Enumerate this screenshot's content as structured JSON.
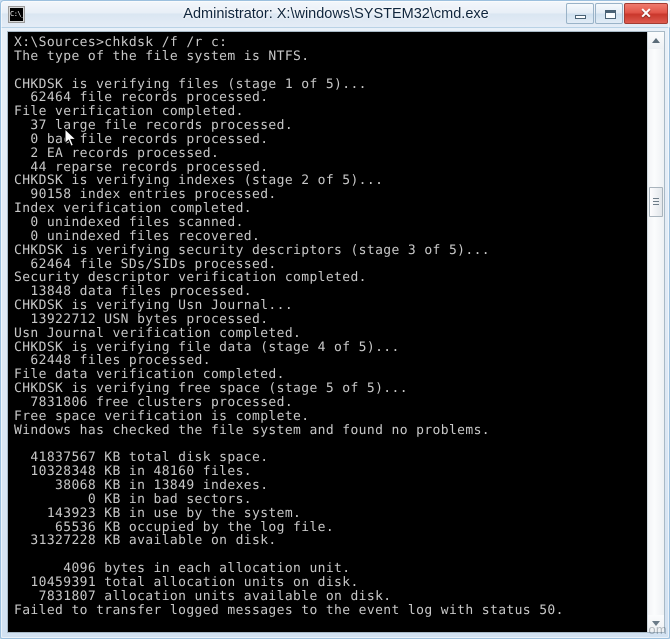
{
  "window": {
    "title": "Administrator: X:\\windows\\SYSTEM32\\cmd.exe",
    "icon_name": "cmd-console-icon",
    "icon_text": "C:\\_",
    "border_color": "#9cc0de",
    "titlebar_text_color": "#10263d"
  },
  "caption_buttons": {
    "minimize_label": "–",
    "maximize_label": "□",
    "close_label": "✕",
    "close_color": "#c9372c"
  },
  "console": {
    "background_color": "#000000",
    "text_color": "#c8c8c8",
    "prompt": "X:\\Sources>",
    "command": "chkdsk /f /r c:",
    "lines": [
      "X:\\Sources>chkdsk /f /r c:",
      "The type of the file system is NTFS.",
      "",
      "CHKDSK is verifying files (stage 1 of 5)...",
      "  62464 file records processed.",
      "File verification completed.",
      "  37 large file records processed.",
      "  0 bad file records processed.",
      "  2 EA records processed.",
      "  44 reparse records processed.",
      "CHKDSK is verifying indexes (stage 2 of 5)...",
      "  90158 index entries processed.",
      "Index verification completed.",
      "  0 unindexed files scanned.",
      "  0 unindexed files recovered.",
      "CHKDSK is verifying security descriptors (stage 3 of 5)...",
      "  62464 file SDs/SIDs processed.",
      "Security descriptor verification completed.",
      "  13848 data files processed.",
      "CHKDSK is verifying Usn Journal...",
      "  13922712 USN bytes processed.",
      "Usn Journal verification completed.",
      "CHKDSK is verifying file data (stage 4 of 5)...",
      "  62448 files processed.",
      "File data verification completed.",
      "CHKDSK is verifying free space (stage 5 of 5)...",
      "  7831806 free clusters processed.",
      "Free space verification is complete.",
      "Windows has checked the file system and found no problems.",
      "",
      "  41837567 KB total disk space.",
      "  10328348 KB in 48160 files.",
      "     38068 KB in 13849 indexes.",
      "         0 KB in bad sectors.",
      "    143923 KB in use by the system.",
      "     65536 KB occupied by the log file.",
      "  31327228 KB available on disk.",
      "",
      "      4096 bytes in each allocation unit.",
      "  10459391 total allocation units on disk.",
      "   7831807 allocation units available on disk.",
      "Failed to transfer logged messages to the event log with status 50."
    ],
    "stats": {
      "total_disk_space_kb": 41837567,
      "in_files_kb": 10328348,
      "file_count": 48160,
      "in_indexes_kb": 38068,
      "index_count": 13849,
      "bad_sectors_kb": 0,
      "in_use_by_system_kb": 143923,
      "log_file_kb": 65536,
      "available_kb": 31327228,
      "bytes_per_allocation_unit": 4096,
      "total_allocation_units": 10459391,
      "available_allocation_units": 7831807
    },
    "stage_counts": {
      "file_records_processed": 62464,
      "large_file_records_processed": 37,
      "bad_file_records_processed": 0,
      "ea_records_processed": 2,
      "reparse_records_processed": 44,
      "index_entries_processed": 90158,
      "unindexed_files_scanned": 0,
      "unindexed_files_recovered": 0,
      "file_sds_sids_processed": 62464,
      "data_files_processed": 13848,
      "usn_bytes_processed": 13922712,
      "files_processed": 62448,
      "free_clusters_processed": 7831806,
      "total_stages": 5
    },
    "error_status_code": "50"
  },
  "scrollbar": {
    "up_arrow_name": "scroll-up-arrow",
    "down_arrow_name": "scroll-down-arrow",
    "thumb_position_percent": 26
  },
  "watermark": {
    "text": "om"
  }
}
